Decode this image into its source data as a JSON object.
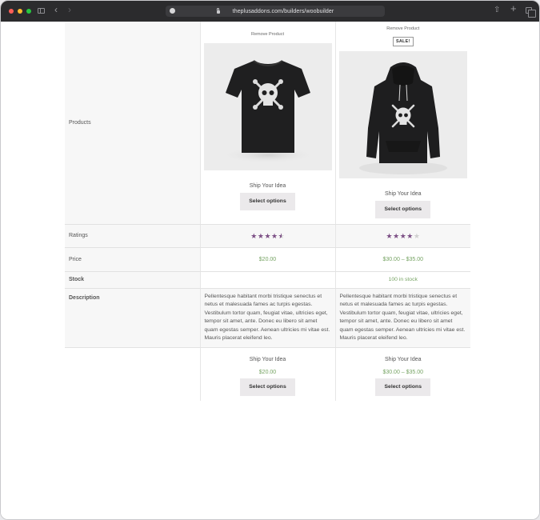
{
  "browser": {
    "url": "theplusaddons.com/builders/woobuilder"
  },
  "labels": {
    "products": "Products",
    "ratings": "Ratings",
    "price": "Price",
    "stock": "Stock",
    "description": "Description"
  },
  "products": [
    {
      "remove": "Remove Product",
      "sale": "",
      "title": "Ship Your Idea",
      "button": "Select options",
      "rating": 4.5,
      "price": "$20.00",
      "stock": "",
      "description": "Pellentesque habitant morbi tristique senectus et netus et malesuada fames ac turpis egestas. Vestibulum tortor quam, feugiat vitae, ultricies eget, tempor sit amet, ante. Donec eu libero sit amet quam egestas semper. Aenean ultricies mi vitae est. Mauris placerat eleifend leo.",
      "image": "black-tshirt"
    },
    {
      "remove": "Remove Product",
      "sale": "SALE!",
      "title": "Ship Your Idea",
      "button": "Select options",
      "rating": 4,
      "price": "$30.00 – $35.00",
      "stock": "100 in stock",
      "description": "Pellentesque habitant morbi tristique senectus et netus et malesuada fames ac turpis egestas. Vestibulum tortor quam, feugiat vitae, ultricies eget, tempor sit amet, ante. Donec eu libero sit amet quam egestas semper. Aenean ultricies mi vitae est. Mauris placerat eleifend leo.",
      "image": "black-hoodie"
    }
  ],
  "colors": {
    "star": "#7c4f85",
    "price": "#77a464"
  }
}
